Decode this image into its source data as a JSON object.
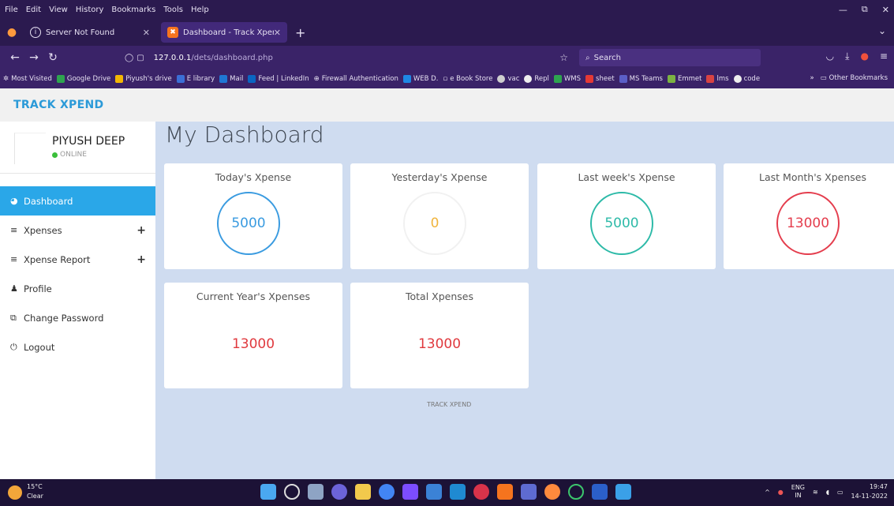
{
  "browser": {
    "menu": [
      "File",
      "Edit",
      "View",
      "History",
      "Bookmarks",
      "Tools",
      "Help"
    ],
    "tabs": [
      {
        "title": "Server Not Found",
        "active": false
      },
      {
        "title": "Dashboard - Track Xpend",
        "active": true
      }
    ],
    "url_host": "127.0.0.1",
    "url_path": "/dets/dashboard.php",
    "search_placeholder": "Search",
    "bookmarks": [
      "Most Visited",
      "Google Drive",
      "Piyush's drive",
      "E library",
      "Mail",
      "Feed | LinkedIn",
      "Firewall Authentication",
      "WEB D.",
      "e Book Store",
      "vac",
      "Repl",
      "WMS",
      "sheet",
      "MS Teams",
      "Emmet",
      "lms",
      "code"
    ],
    "other_bookmarks": "Other Bookmarks"
  },
  "app": {
    "brand": "TRACK XPEND",
    "user": {
      "name": "PIYUSH DEEP",
      "status": "ONLINE"
    },
    "menu": [
      {
        "label": "Dashboard",
        "icon": "dashboard-icon"
      },
      {
        "label": "Xpenses",
        "icon": "list-icon"
      },
      {
        "label": "Xpense Report",
        "icon": "list-icon"
      },
      {
        "label": "Profile",
        "icon": "user-icon"
      },
      {
        "label": "Change Password",
        "icon": "copy-icon"
      },
      {
        "label": "Logout",
        "icon": "power-icon"
      }
    ],
    "page_title": "My Dashboard",
    "cards": [
      {
        "title": "Today's Xpense",
        "value": "5000"
      },
      {
        "title": "Yesterday's Xpense",
        "value": "0"
      },
      {
        "title": "Last week's Xpense",
        "value": "5000"
      },
      {
        "title": "Last Month's Xpenses",
        "value": "13000"
      },
      {
        "title": "Current Year's Xpenses",
        "value": "13000"
      },
      {
        "title": "Total Xpenses",
        "value": "13000"
      }
    ],
    "footer": "TRACK XPEND"
  },
  "taskbar": {
    "temp": "15°C",
    "condition": "Clear",
    "lang": "ENG",
    "region": "IN",
    "time": "19:47",
    "date": "14-11-2022"
  },
  "colors": {
    "accent": "#2aa7e8",
    "ring_blue": "#3a9be0",
    "ring_teal": "#2dbaa8",
    "ring_red": "#e43d4d",
    "value_red": "#e0393e"
  }
}
